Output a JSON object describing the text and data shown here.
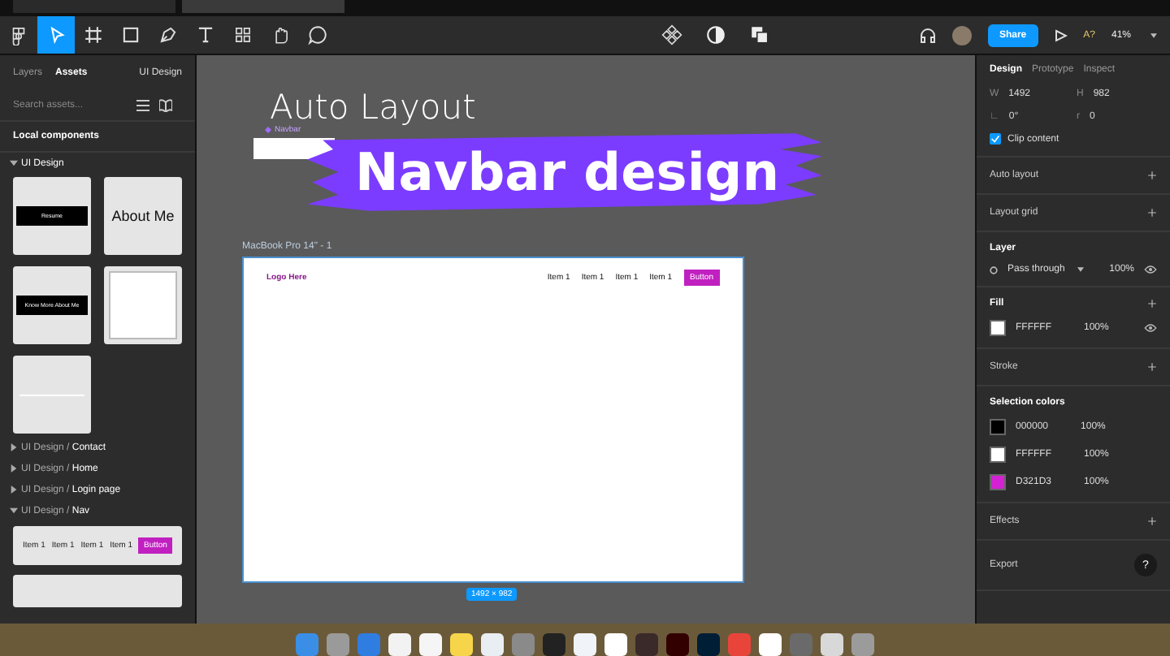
{
  "toolbar": {
    "tools": [
      {
        "kind": "menu",
        "selected": false
      },
      {
        "kind": "move",
        "selected": true
      },
      {
        "kind": "frame",
        "selected": false
      },
      {
        "kind": "shape",
        "selected": false
      },
      {
        "kind": "pen",
        "selected": false
      },
      {
        "kind": "text",
        "selected": false
      },
      {
        "kind": "resources",
        "selected": false
      },
      {
        "kind": "hand",
        "selected": false
      },
      {
        "kind": "comment",
        "selected": false
      }
    ],
    "center_tools": [
      {
        "kind": "component"
      },
      {
        "kind": "mask"
      },
      {
        "kind": "boolean"
      }
    ],
    "share": "Share",
    "ai": "A?",
    "zoom": "41%"
  },
  "left_panel": {
    "tabs": [
      {
        "label": "Layers",
        "selected": false
      },
      {
        "label": "Assets",
        "selected": true
      }
    ],
    "library": "UI Design",
    "search": {
      "placeholder": "Search assets..."
    },
    "section": "Local components",
    "groups": [
      {
        "label": "UI Design",
        "expanded": true,
        "components": [
          {
            "kind": "banner",
            "label": "Resume"
          },
          {
            "kind": "title",
            "label": "About Me"
          },
          {
            "kind": "banner",
            "label": "Know More About Me"
          },
          {
            "kind": "card"
          },
          {
            "kind": "line"
          }
        ]
      },
      {
        "label": "UI Design / **Contact**",
        "expanded": false
      },
      {
        "label": "UI Design / **Home**",
        "expanded": false
      },
      {
        "label": "UI Design / **Login page**",
        "expanded": false
      },
      {
        "label": "UI Design / **Nav**",
        "expanded": true,
        "components": [
          {
            "kind": "nav",
            "items": [
              "Item 1",
              "Item 1",
              "Item 1",
              "Item 1"
            ],
            "button": "Button"
          },
          {
            "kind": "partial"
          }
        ]
      }
    ]
  },
  "canvas": {
    "heading": "Auto Layout",
    "layer_tag": "Navbar",
    "banner": "Navbar design",
    "frame": {
      "label": "MacBook Pro 14\" - 1",
      "logo": "Logo Here",
      "items": [
        "Item 1",
        "Item 1",
        "Item 1",
        "Item 1"
      ],
      "button": "Button",
      "size": "1492 × 982"
    }
  },
  "right_panel": {
    "tabs": [
      {
        "label": "Design",
        "selected": true
      },
      {
        "label": "Prototype",
        "selected": false
      },
      {
        "label": "Inspect",
        "selected": false
      }
    ],
    "fields": [
      {
        "label": "W",
        "value": "1492"
      },
      {
        "label": "H",
        "value": "982"
      },
      {
        "label": "∟",
        "value": "0°"
      },
      {
        "label": "r",
        "value": "0"
      }
    ],
    "clip_content": {
      "label": "Clip content",
      "checked": true
    },
    "sections": [
      {
        "title": "Auto layout",
        "bold": false
      },
      {
        "title": "Layout grid",
        "bold": false
      }
    ],
    "layer": {
      "title": "Layer",
      "blend": "Pass through",
      "opacity": "100%"
    },
    "fill": {
      "title": "Fill",
      "hex": "FFFFFF",
      "opacity": "100%",
      "color": "#ffffff"
    },
    "stroke": "Stroke",
    "selection_colors": {
      "title": "Selection colors",
      "items": [
        {
          "hex": "000000",
          "opacity": "100%",
          "color": "#000000"
        },
        {
          "hex": "FFFFFF",
          "opacity": "100%",
          "color": "#ffffff"
        },
        {
          "hex": "D321D3",
          "opacity": "100%",
          "color": "#d321d3"
        }
      ]
    },
    "bottom_sections": [
      "Effects",
      "Export"
    ],
    "help": "?"
  },
  "dock": [
    {
      "color": "#3a8ee6"
    },
    {
      "color": "#9a9a9a"
    },
    {
      "color": "#2f7de1"
    },
    {
      "color": "#f2f2f2"
    },
    {
      "color": "#f5f5f5"
    },
    {
      "color": "#f7d54a"
    },
    {
      "color": "#e9eef3"
    },
    {
      "color": "#8a8a8a"
    },
    {
      "color": "#222222"
    },
    {
      "color": "#f0f3f8"
    },
    {
      "color": "#ffffff"
    },
    {
      "color": "#3a2a2a"
    },
    {
      "color": "#330000"
    },
    {
      "color": "#001e36"
    },
    {
      "color": "#e8443a"
    },
    {
      "color": "#ffffff"
    },
    {
      "color": "#6a6a6a"
    },
    {
      "color": "#d8d8d8"
    },
    {
      "color": "#9b9b9b"
    }
  ]
}
